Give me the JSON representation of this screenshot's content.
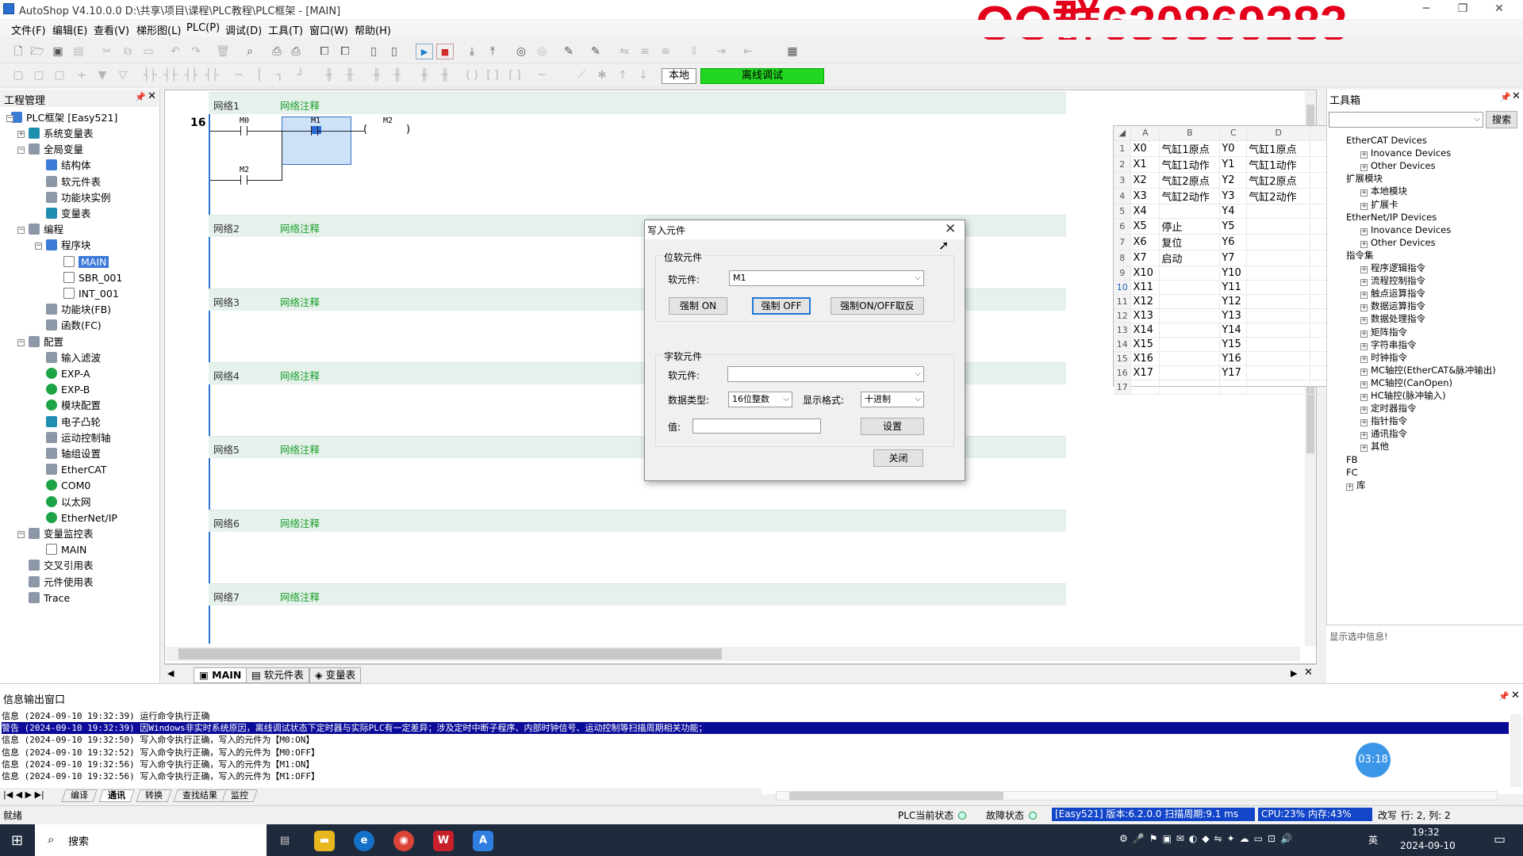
{
  "window": {
    "title": "AutoShop V4.10.0.0  D:\\共享\\项目\\课程\\PLC教程\\PLC框架 - [MAIN]",
    "minimize": "─",
    "restore": "❐",
    "close": "✕"
  },
  "watermark": "QQ群630869283",
  "menu": [
    "文件(F)",
    "编辑(E)",
    "查看(V)",
    "梯形图(L)",
    "PLC(P)",
    "调试(D)",
    "工具(T)",
    "窗口(W)",
    "帮助(H)"
  ],
  "mode": {
    "local": "本地",
    "offline": "离线调试"
  },
  "project": {
    "title": "工程管理",
    "root": "PLC框架 [Easy521]",
    "items": [
      {
        "label": "系统变量表",
        "indent": 1,
        "icon": "teal"
      },
      {
        "label": "全局变量",
        "indent": 1,
        "icon": "gray"
      },
      {
        "label": "结构体",
        "indent": 2,
        "icon": "blue"
      },
      {
        "label": "软元件表",
        "indent": 2,
        "icon": "gray"
      },
      {
        "label": "功能块实例",
        "indent": 2,
        "icon": "gray"
      },
      {
        "label": "变量表",
        "indent": 2,
        "icon": "teal"
      },
      {
        "label": "编程",
        "indent": 1,
        "icon": "gray"
      },
      {
        "label": "程序块",
        "indent": 2,
        "icon": "blue"
      },
      {
        "label": "MAIN",
        "indent": 3,
        "icon": "doc",
        "selected": true
      },
      {
        "label": "SBR_001",
        "indent": 3,
        "icon": "doc"
      },
      {
        "label": "INT_001",
        "indent": 3,
        "icon": "doc"
      },
      {
        "label": "功能块(FB)",
        "indent": 2,
        "icon": "gray"
      },
      {
        "label": "函数(FC)",
        "indent": 2,
        "icon": "gray"
      },
      {
        "label": "配置",
        "indent": 1,
        "icon": "gray"
      },
      {
        "label": "输入滤波",
        "indent": 2,
        "icon": "gray"
      },
      {
        "label": "EXP-A",
        "indent": 2,
        "icon": "green"
      },
      {
        "label": "EXP-B",
        "indent": 2,
        "icon": "green"
      },
      {
        "label": "模块配置",
        "indent": 2,
        "icon": "green"
      },
      {
        "label": "电子凸轮",
        "indent": 2,
        "icon": "teal"
      },
      {
        "label": "运动控制轴",
        "indent": 2,
        "icon": "gray"
      },
      {
        "label": "轴组设置",
        "indent": 2,
        "icon": "gray"
      },
      {
        "label": "EtherCAT",
        "indent": 2,
        "icon": "gray"
      },
      {
        "label": "COM0",
        "indent": 2,
        "icon": "green"
      },
      {
        "label": "以太网",
        "indent": 2,
        "icon": "green"
      },
      {
        "label": "EtherNet/IP",
        "indent": 2,
        "icon": "green"
      },
      {
        "label": "变量监控表",
        "indent": 1,
        "icon": "gray"
      },
      {
        "label": "MAIN",
        "indent": 2,
        "icon": "doc"
      },
      {
        "label": "交叉引用表",
        "indent": 1,
        "icon": "gray"
      },
      {
        "label": "元件使用表",
        "indent": 1,
        "icon": "gray"
      },
      {
        "label": "Trace",
        "indent": 1,
        "icon": "gray"
      }
    ]
  },
  "ladder": {
    "rung_no": "16",
    "comment": "网络注释",
    "networks": [
      "网络1",
      "网络2",
      "网络3",
      "网络4",
      "网络5",
      "网络6",
      "网络7"
    ],
    "contacts": {
      "m0": "M0",
      "m1": "M1",
      "m2a": "M2",
      "m2b": "M2"
    }
  },
  "editor_tabs": [
    "MAIN",
    "软元件表",
    "变量表"
  ],
  "sheet": {
    "cols": [
      "A",
      "B",
      "C",
      "D"
    ],
    "rows": [
      [
        "X0",
        "气缸1原点",
        "Y0",
        "气缸1原点"
      ],
      [
        "X1",
        "气缸1动作",
        "Y1",
        "气缸1动作"
      ],
      [
        "X2",
        "气缸2原点",
        "Y2",
        "气缸2原点"
      ],
      [
        "X3",
        "气缸2动作",
        "Y3",
        "气缸2动作"
      ],
      [
        "X4",
        "",
        "Y4",
        ""
      ],
      [
        "X5",
        "停止",
        "Y5",
        ""
      ],
      [
        "X6",
        "复位",
        "Y6",
        ""
      ],
      [
        "X7",
        "启动",
        "Y7",
        ""
      ],
      [
        "X10",
        "",
        "Y10",
        ""
      ],
      [
        "X11",
        "",
        "Y11",
        ""
      ],
      [
        "X12",
        "",
        "Y12",
        ""
      ],
      [
        "X13",
        "",
        "Y13",
        ""
      ],
      [
        "X14",
        "",
        "Y14",
        ""
      ],
      [
        "X15",
        "",
        "Y15",
        ""
      ],
      [
        "X16",
        "",
        "Y16",
        ""
      ],
      [
        "X17",
        "",
        "Y17",
        ""
      ],
      [
        "",
        "",
        "",
        ""
      ]
    ]
  },
  "dialog": {
    "title": "写入元件",
    "bit_group": "位软元件",
    "word_group": "字软元件",
    "device_label": "软元件:",
    "bit_device": "M1",
    "force_on": "强制 ON",
    "force_off": "强制 OFF",
    "force_toggle": "强制ON/OFF取反",
    "data_type_label": "数据类型:",
    "data_type": "16位整数",
    "format_label": "显示格式:",
    "format": "十进制",
    "value_label": "值:",
    "set": "设置",
    "close": "关闭"
  },
  "toolbox": {
    "title": "工具箱",
    "search": "搜索",
    "info": "显示选中信息!",
    "items": [
      {
        "t": "EtherCAT Devices",
        "l": 0
      },
      {
        "t": "Inovance Devices",
        "l": 1
      },
      {
        "t": "Other Devices",
        "l": 1
      },
      {
        "t": "扩展模块",
        "l": 0
      },
      {
        "t": "本地模块",
        "l": 1
      },
      {
        "t": "扩展卡",
        "l": 1
      },
      {
        "t": "EtherNet/IP Devices",
        "l": 0
      },
      {
        "t": "Inovance Devices",
        "l": 1
      },
      {
        "t": "Other Devices",
        "l": 1
      },
      {
        "t": "指令集",
        "l": 0
      },
      {
        "t": "程序逻辑指令",
        "l": 1
      },
      {
        "t": "流程控制指令",
        "l": 1
      },
      {
        "t": "触点运算指令",
        "l": 1
      },
      {
        "t": "数据运算指令",
        "l": 1
      },
      {
        "t": "数据处理指令",
        "l": 1
      },
      {
        "t": "矩阵指令",
        "l": 1
      },
      {
        "t": "字符串指令",
        "l": 1
      },
      {
        "t": "时钟指令",
        "l": 1
      },
      {
        "t": "MC轴控(EtherCAT&脉冲输出)",
        "l": 1
      },
      {
        "t": "MC轴控(CanOpen)",
        "l": 1
      },
      {
        "t": "HC轴控(脉冲输入)",
        "l": 1
      },
      {
        "t": "定时器指令",
        "l": 1
      },
      {
        "t": "指针指令",
        "l": 1
      },
      {
        "t": "通讯指令",
        "l": 1
      },
      {
        "t": "其他",
        "l": 1
      },
      {
        "t": "FB",
        "l": 0
      },
      {
        "t": "FC",
        "l": 0
      },
      {
        "t": "库",
        "l": 0
      }
    ]
  },
  "output": {
    "title": "信息输出窗口",
    "lines": [
      "信息  (2024-09-10 19:32:39)  运行命令执行正确",
      "警告  (2024-09-10 19:32:39)  因Windows非实时系统原因，离线调试状态下定时器与实际PLC有一定差异；涉及定时中断子程序、内部时钟信号、运动控制等扫描周期相关功能；",
      "信息  (2024-09-10 19:32:50)  写入命令执行正确，写入的元件为【M0:ON】",
      "信息  (2024-09-10 19:32:52)  写入命令执行正确，写入的元件为【M0:OFF】",
      "信息  (2024-09-10 19:32:56)  写入命令执行正确，写入的元件为【M1:ON】",
      "信息  (2024-09-10 19:32:56)  写入命令执行正确，写入的元件为【M1:OFF】"
    ],
    "tabs": [
      "编译",
      "通讯",
      "转换",
      "查找结果",
      "监控"
    ]
  },
  "timer": "03:18",
  "status": {
    "ready": "就绪",
    "plc_state": "PLC当前状态",
    "fault_state": "故障状态",
    "version": "[Easy521] 版本:6.2.0.0 扫描周期:9.1 ms",
    "cpu": "CPU:23% 内存:43%",
    "mode": "改写",
    "pos": "行: 2, 列: 2"
  },
  "taskbar": {
    "search": "搜索",
    "time": "19:32",
    "date": "2024-09-10",
    "lang": "英"
  }
}
